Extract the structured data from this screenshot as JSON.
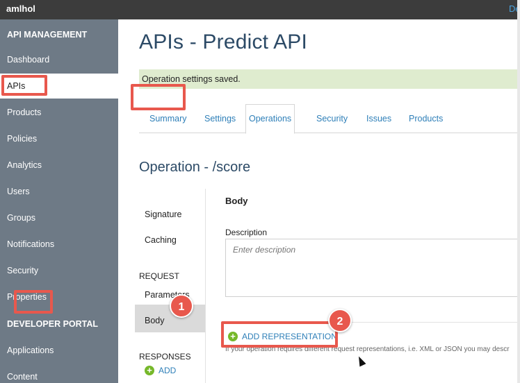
{
  "topbar": {
    "account": "amlhol",
    "right_link": "De"
  },
  "sidebar": {
    "section_api": "API MANAGEMENT",
    "items": [
      "Dashboard",
      "APIs",
      "Products",
      "Policies",
      "Analytics",
      "Users",
      "Groups",
      "Notifications",
      "Security",
      "Properties"
    ],
    "active_item": "APIs",
    "section_dev": "DEVELOPER PORTAL",
    "dev_items": [
      "Applications",
      "Content"
    ]
  },
  "main": {
    "title": "APIs - Predict API",
    "notice": "Operation settings saved.",
    "tabs": [
      "Summary",
      "Settings",
      "Operations",
      "Security",
      "Issues",
      "Products"
    ],
    "active_tab": "Operations",
    "operation_title": "Operation - /score"
  },
  "subnav": {
    "items": [
      "Signature",
      "Caching"
    ],
    "request_heading": "REQUEST",
    "request_items": [
      "Parameters",
      "Body"
    ],
    "active_item": "Body",
    "responses_heading": "RESPONSES",
    "add_label": "ADD"
  },
  "body_pane": {
    "heading": "Body",
    "description_label": "Description",
    "description_placeholder": "Enter description",
    "add_representation": "ADD REPRESENTATION",
    "helper_text": "If your operation requires different request representations, i.e. XML or JSON you may descr"
  },
  "callouts": [
    "1",
    "2"
  ],
  "colors": {
    "sidebar": "#6e7a86",
    "accent": "#2e7fb8",
    "highlight": "#e8584d",
    "notice": "#dfeccf",
    "add_icon": "#76b82a"
  }
}
